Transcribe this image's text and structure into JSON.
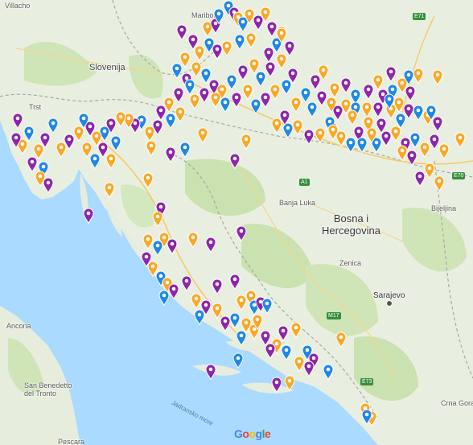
{
  "labels": {
    "villacho": "Villacho",
    "maribor": "Maribor",
    "slovenija": "Slovenija",
    "trst": "Trst",
    "bosna": "Bosna i",
    "hercegovina": "Hercegovina",
    "banja_luka": "Banja Luka",
    "zenica": "Zenica",
    "sarajevo": "Sarajevo",
    "ancona": "Ancona",
    "san_benedetto": "San Benedetto\ndel Tronto",
    "pescara": "Pescara",
    "jadransko_more": "Jadransko more",
    "crna_gora": "Crna Gora",
    "bijeljina": "Bijeljina"
  },
  "road_shields": [
    "E71",
    "A1",
    "E70",
    "E73",
    "M17"
  ],
  "brand": {
    "g1": "G",
    "o1": "o",
    "o2": "o",
    "g2": "g",
    "l": "l",
    "e": "e"
  },
  "colors": {
    "orange": "#f9a825",
    "purple": "#8e24aa",
    "blue": "#1e88e5",
    "sea": "#aadaff",
    "land": "#e8f0e0",
    "green": "#c5e1a5"
  },
  "marker_types": [
    "orange",
    "purple",
    "blue"
  ],
  "markers": [
    [
      "blue",
      284,
      12
    ],
    [
      "purple",
      226,
      50
    ],
    [
      "orange",
      258,
      46
    ],
    [
      "purple",
      268,
      42
    ],
    [
      "blue",
      272,
      30
    ],
    [
      "purple",
      291,
      28
    ],
    [
      "orange",
      296,
      34
    ],
    [
      "blue",
      302,
      40
    ],
    [
      "orange",
      310,
      30
    ],
    [
      "purple",
      321,
      38
    ],
    [
      "orange",
      330,
      28
    ],
    [
      "purple",
      338,
      46
    ],
    [
      "orange",
      350,
      52
    ],
    [
      "blue",
      344,
      66
    ],
    [
      "purple",
      360,
      70
    ],
    [
      "purple",
      334,
      78
    ],
    [
      "orange",
      312,
      60
    ],
    [
      "blue",
      298,
      62
    ],
    [
      "orange",
      282,
      70
    ],
    [
      "purple",
      270,
      74
    ],
    [
      "blue",
      260,
      66
    ],
    [
      "orange",
      248,
      76
    ],
    [
      "purple",
      240,
      62
    ],
    [
      "orange",
      230,
      84
    ],
    [
      "blue",
      220,
      98
    ],
    [
      "purple",
      232,
      110
    ],
    [
      "orange",
      244,
      96
    ],
    [
      "blue",
      256,
      104
    ],
    [
      "purple",
      266,
      118
    ],
    [
      "orange",
      276,
      124
    ],
    [
      "blue",
      288,
      112
    ],
    [
      "purple",
      302,
      100
    ],
    [
      "orange",
      316,
      92
    ],
    [
      "blue",
      324,
      108
    ],
    [
      "purple",
      336,
      96
    ],
    [
      "orange",
      350,
      86
    ],
    [
      "purple",
      364,
      104
    ],
    [
      "blue",
      356,
      118
    ],
    [
      "orange",
      342,
      124
    ],
    [
      "purple",
      330,
      134
    ],
    [
      "blue",
      318,
      142
    ],
    [
      "orange",
      308,
      124
    ],
    [
      "purple",
      294,
      134
    ],
    [
      "blue",
      280,
      140
    ],
    [
      "orange",
      268,
      134
    ],
    [
      "purple",
      254,
      128
    ],
    [
      "orange",
      242,
      136
    ],
    [
      "blue",
      236,
      118
    ],
    [
      "purple",
      222,
      128
    ],
    [
      "orange",
      210,
      140
    ],
    [
      "purple",
      200,
      150
    ],
    [
      "blue",
      212,
      160
    ],
    [
      "orange",
      224,
      152
    ],
    [
      "purple",
      196,
      168
    ],
    [
      "orange",
      186,
      176
    ],
    [
      "blue",
      176,
      162
    ],
    [
      "purple",
      168,
      166
    ],
    [
      "orange",
      160,
      160
    ],
    [
      "orange",
      150,
      158
    ],
    [
      "purple",
      138,
      166
    ],
    [
      "blue",
      130,
      176
    ],
    [
      "orange",
      120,
      182
    ],
    [
      "purple",
      112,
      170
    ],
    [
      "blue",
      104,
      160
    ],
    [
      "orange",
      98,
      176
    ],
    [
      "purple",
      86,
      186
    ],
    [
      "orange",
      76,
      196
    ],
    [
      "blue",
      66,
      166
    ],
    [
      "purple",
      56,
      184
    ],
    [
      "orange",
      48,
      198
    ],
    [
      "blue",
      36,
      176
    ],
    [
      "purple",
      22,
      160
    ],
    [
      "orange",
      28,
      192
    ],
    [
      "purple",
      40,
      214
    ],
    [
      "blue",
      54,
      220
    ],
    [
      "orange",
      50,
      232
    ],
    [
      "purple",
      60,
      240
    ],
    [
      "purple",
      20,
      184
    ],
    [
      "orange",
      108,
      196
    ],
    [
      "blue",
      118,
      210
    ],
    [
      "purple",
      128,
      196
    ],
    [
      "orange",
      138,
      210
    ],
    [
      "blue",
      144,
      188
    ],
    [
      "orange",
      188,
      194
    ],
    [
      "purple",
      212,
      202
    ],
    [
      "blue",
      230,
      196
    ],
    [
      "orange",
      252,
      178
    ],
    [
      "purple",
      292,
      210
    ],
    [
      "orange",
      306,
      186
    ],
    [
      "purple",
      110,
      278
    ],
    [
      "orange",
      136,
      246
    ],
    [
      "orange",
      184,
      234
    ],
    [
      "purple",
      200,
      270
    ],
    [
      "orange",
      196,
      282
    ],
    [
      "orange",
      204,
      308
    ],
    [
      "purple",
      214,
      316
    ],
    [
      "blue",
      196,
      318
    ],
    [
      "orange",
      184,
      310
    ],
    [
      "purple",
      182,
      332
    ],
    [
      "orange",
      190,
      344
    ],
    [
      "blue",
      200,
      356
    ],
    [
      "orange",
      208,
      364
    ],
    [
      "purple",
      216,
      372
    ],
    [
      "blue",
      204,
      380
    ],
    [
      "purple",
      232,
      362
    ],
    [
      "orange",
      240,
      308
    ],
    [
      "purple",
      262,
      314
    ],
    [
      "purple",
      270,
      366
    ],
    [
      "orange",
      244,
      384
    ],
    [
      "purple",
      256,
      392
    ],
    [
      "blue",
      248,
      404
    ],
    [
      "orange",
      270,
      396
    ],
    [
      "purple",
      280,
      412
    ],
    [
      "blue",
      292,
      408
    ],
    [
      "orange",
      300,
      386
    ],
    [
      "purple",
      292,
      360
    ],
    [
      "orange",
      312,
      380
    ],
    [
      "blue",
      316,
      392
    ],
    [
      "purple",
      324,
      388
    ],
    [
      "orange",
      306,
      414
    ],
    [
      "blue",
      300,
      430
    ],
    [
      "orange",
      316,
      422
    ],
    [
      "purple",
      330,
      430
    ],
    [
      "orange",
      344,
      440
    ],
    [
      "blue",
      356,
      448
    ],
    [
      "purple",
      352,
      424
    ],
    [
      "orange",
      368,
      420
    ],
    [
      "blue",
      382,
      448
    ],
    [
      "purple",
      390,
      458
    ],
    [
      "blue",
      408,
      472
    ],
    [
      "purple",
      384,
      468
    ],
    [
      "orange",
      372,
      462
    ],
    [
      "purple",
      344,
      488
    ],
    [
      "orange",
      360,
      486
    ],
    [
      "purple",
      262,
      472
    ],
    [
      "blue",
      296,
      458
    ],
    [
      "orange",
      424,
      432
    ],
    [
      "orange",
      454,
      520
    ],
    [
      "orange",
      462,
      530
    ],
    [
      "blue",
      456,
      528
    ],
    [
      "orange",
      350,
      54
    ],
    [
      "purple",
      412,
      170
    ],
    [
      "orange",
      424,
      182
    ],
    [
      "blue",
      436,
      190
    ],
    [
      "purple",
      446,
      176
    ],
    [
      "orange",
      458,
      164
    ],
    [
      "blue",
      468,
      190
    ],
    [
      "purple",
      480,
      182
    ],
    [
      "orange",
      492,
      176
    ],
    [
      "purple",
      504,
      190
    ],
    [
      "blue",
      516,
      184
    ],
    [
      "orange",
      528,
      196
    ],
    [
      "purple",
      540,
      186
    ],
    [
      "orange",
      552,
      198
    ],
    [
      "blue",
      498,
      160
    ],
    [
      "orange",
      486,
      148
    ],
    [
      "purple",
      476,
      130
    ],
    [
      "blue",
      488,
      124
    ],
    [
      "orange",
      500,
      116
    ],
    [
      "purple",
      510,
      126
    ],
    [
      "orange",
      520,
      104
    ],
    [
      "blue",
      508,
      106
    ],
    [
      "purple",
      486,
      102
    ],
    [
      "orange",
      470,
      112
    ],
    [
      "purple",
      458,
      124
    ],
    [
      "blue",
      442,
      130
    ],
    [
      "orange",
      430,
      142
    ],
    [
      "purple",
      420,
      150
    ],
    [
      "blue",
      410,
      164
    ],
    [
      "orange",
      398,
      178
    ],
    [
      "purple",
      384,
      180
    ],
    [
      "orange",
      370,
      168
    ],
    [
      "blue",
      358,
      172
    ],
    [
      "orange",
      344,
      166
    ],
    [
      "purple",
      354,
      156
    ],
    [
      "orange",
      368,
      140
    ],
    [
      "blue",
      380,
      128
    ],
    [
      "purple",
      392,
      112
    ],
    [
      "orange",
      402,
      100
    ],
    [
      "orange",
      416,
      122
    ],
    [
      "purple",
      430,
      116
    ],
    [
      "blue",
      442,
      146
    ],
    [
      "orange",
      456,
      146
    ],
    [
      "purple",
      470,
      146
    ],
    [
      "blue",
      484,
      136
    ],
    [
      "orange",
      496,
      140
    ],
    [
      "purple",
      508,
      148
    ],
    [
      "blue",
      520,
      150
    ],
    [
      "orange",
      532,
      156
    ],
    [
      "purple",
      544,
      164
    ],
    [
      "orange",
      572,
      184
    ],
    [
      "blue",
      536,
      150
    ],
    [
      "purple",
      522,
      232
    ],
    [
      "orange",
      534,
      222
    ],
    [
      "orange",
      546,
      238
    ],
    [
      "purple",
      512,
      206
    ],
    [
      "orange",
      500,
      200
    ],
    [
      "orange",
      544,
      106
    ],
    [
      "purple",
      474,
      166
    ],
    [
      "orange",
      462,
      178
    ],
    [
      "blue",
      450,
      190
    ],
    [
      "orange",
      438,
      156
    ],
    [
      "purple",
      400,
      132
    ],
    [
      "blue",
      388,
      146
    ],
    [
      "orange",
      412,
      140
    ],
    [
      "purple",
      300,
      300
    ],
    [
      "blue",
      332,
      390
    ],
    [
      "orange",
      320,
      410
    ],
    [
      "purple",
      336,
      446
    ],
    [
      "orange",
      414,
      174
    ]
  ]
}
